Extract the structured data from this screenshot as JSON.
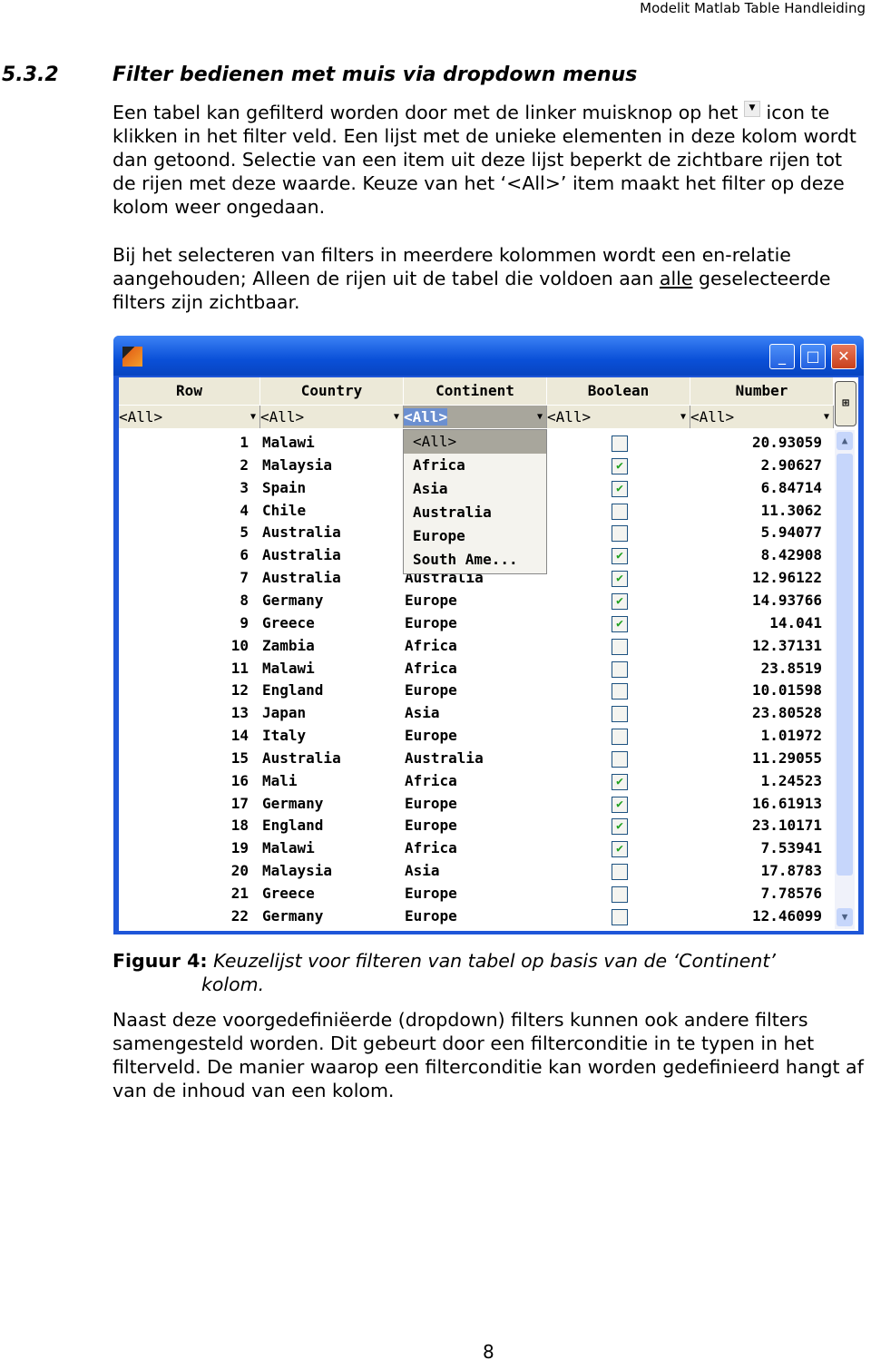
{
  "header": "Modelit Matlab Table Handleiding",
  "section": {
    "number": "5.3.2",
    "title": "Filter bedienen met muis via dropdown menus"
  },
  "para1": {
    "before": "Een tabel kan gefilterd worden door met de linker muisknop op het",
    "icon": "dropdown-arrow-icon",
    "after": "icon te klikken in het filter veld. Een lijst met de unieke elementen in deze kolom wordt dan getoond. Selectie van een item uit deze lijst beperkt de zichtbare rijen tot de rijen met deze waarde. Keuze van het ‘<All>’ item maakt het filter op deze kolom weer ongedaan."
  },
  "para2": {
    "before": "Bij het selecteren van filters in meerdere kolommen wordt een en-relatie aangehouden; Alleen de rijen uit de tabel die voldoen aan",
    "underlined": "alle",
    "after": "geselecteerde filters zijn zichtbaar."
  },
  "window": {
    "columns": [
      "Row",
      "Country",
      "Continent",
      "Boolean",
      "Number"
    ],
    "filters": [
      "<All>",
      "<All>",
      "<All>",
      "<All>",
      "<All>"
    ],
    "active_filter": "Continent",
    "dropdown": [
      "<All>",
      "Africa",
      "Asia",
      "Australia",
      "Europe",
      "South Ame..."
    ],
    "rows": [
      {
        "row": "1",
        "country": "Malawi",
        "continent": "",
        "checked": false,
        "number": "20.93059"
      },
      {
        "row": "2",
        "country": "Malaysia",
        "continent": "",
        "checked": true,
        "number": "2.90627"
      },
      {
        "row": "3",
        "country": "Spain",
        "continent": "",
        "checked": true,
        "number": "6.84714"
      },
      {
        "row": "4",
        "country": "Chile",
        "continent": "",
        "checked": false,
        "number": "11.3062"
      },
      {
        "row": "5",
        "country": "Australia",
        "continent": "",
        "checked": false,
        "number": "5.94077"
      },
      {
        "row": "6",
        "country": "Australia",
        "continent": "",
        "checked": true,
        "number": "8.42908"
      },
      {
        "row": "7",
        "country": "Australia",
        "continent": "Australia",
        "checked": true,
        "number": "12.96122"
      },
      {
        "row": "8",
        "country": "Germany",
        "continent": "Europe",
        "checked": true,
        "number": "14.93766"
      },
      {
        "row": "9",
        "country": "Greece",
        "continent": "Europe",
        "checked": true,
        "number": "14.041"
      },
      {
        "row": "10",
        "country": "Zambia",
        "continent": "Africa",
        "checked": false,
        "number": "12.37131"
      },
      {
        "row": "11",
        "country": "Malawi",
        "continent": "Africa",
        "checked": false,
        "number": "23.8519"
      },
      {
        "row": "12",
        "country": "England",
        "continent": "Europe",
        "checked": false,
        "number": "10.01598"
      },
      {
        "row": "13",
        "country": "Japan",
        "continent": "Asia",
        "checked": false,
        "number": "23.80528"
      },
      {
        "row": "14",
        "country": "Italy",
        "continent": "Europe",
        "checked": false,
        "number": "1.01972"
      },
      {
        "row": "15",
        "country": "Australia",
        "continent": "Australia",
        "checked": false,
        "number": "11.29055"
      },
      {
        "row": "16",
        "country": "Mali",
        "continent": "Africa",
        "checked": true,
        "number": "1.24523"
      },
      {
        "row": "17",
        "country": "Germany",
        "continent": "Europe",
        "checked": true,
        "number": "16.61913"
      },
      {
        "row": "18",
        "country": "England",
        "continent": "Europe",
        "checked": true,
        "number": "23.10171"
      },
      {
        "row": "19",
        "country": "Malawi",
        "continent": "Africa",
        "checked": true,
        "number": "7.53941"
      },
      {
        "row": "20",
        "country": "Malaysia",
        "continent": "Asia",
        "checked": false,
        "number": "17.8783"
      },
      {
        "row": "21",
        "country": "Greece",
        "continent": "Europe",
        "checked": false,
        "number": "7.78576"
      },
      {
        "row": "22",
        "country": "Germany",
        "continent": "Europe",
        "checked": false,
        "number": "12.46099"
      }
    ]
  },
  "caption": {
    "label": "Figuur 4:",
    "text": "Keuzelijst voor filteren van tabel op basis van de ‘Continent’",
    "text2": "kolom."
  },
  "para3": "Naast deze voorgedefiniëerde (dropdown) filters kunnen ook andere filters samengesteld worden. Dit gebeurt door een filterconditie in te typen in het filterveld. De manier waarop een filterconditie kan worden gedefinieerd hangt af van de inhoud van een kolom.",
  "page_number": "8"
}
